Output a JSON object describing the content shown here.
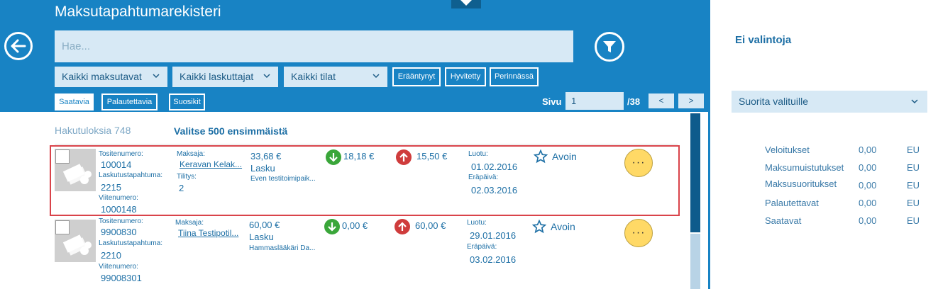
{
  "header": {
    "title": "Maksutapahtumarekisteri",
    "search_placeholder": "Hae...",
    "filters": {
      "payment_types": "Kaikki maksutavat",
      "billers": "Kaikki laskuttajat",
      "states": "Kaikki tilat"
    },
    "toggles": [
      "Erääntynyt",
      "Hyvitetty",
      "Perinnässä"
    ],
    "tabs": [
      "Saatavia",
      "Palautettavia",
      "Suosikit"
    ],
    "pager": {
      "label": "Sivu",
      "current": "1",
      "total": "/38",
      "prev": "<",
      "next": ">"
    }
  },
  "results": {
    "count_text": "Hakutuloksia 748",
    "select_text": "Valitse 500 ensimmäistä",
    "labels": {
      "voucher": "Tositenumero:",
      "billing_event": "Laskutustapahtuma:",
      "reference": "Viitenumero:",
      "payer": "Maksaja:",
      "settlement": "Tilitys:",
      "created": "Luotu:",
      "due": "Eräpäivä:"
    },
    "rows": [
      {
        "voucher": "100014",
        "billing_event": "2215",
        "reference": "1000148",
        "payer": "Keravan Kelak...",
        "settlement": "2",
        "amount": "33,68 €",
        "type": "Lasku",
        "description": "Even testitoimipaik...",
        "incoming": "18,18 €",
        "outgoing": "15,50 €",
        "created": "01.02.2016",
        "due": "02.03.2016",
        "status": "Avoin",
        "more": "···"
      },
      {
        "voucher": "9900830",
        "billing_event": "2210",
        "reference": "99008301",
        "payer": "Tiina Testipotil...",
        "amount": "60,00 €",
        "type": "Lasku",
        "description": "Hammaslääkäri Da...",
        "incoming": "0,00 €",
        "outgoing": "60,00 €",
        "created": "29.01.2016",
        "due": "03.02.2016",
        "status": "Avoin",
        "more": "···"
      }
    ]
  },
  "side_panel": {
    "title": "Ei valintoja",
    "action": "Suorita valituille",
    "summary": [
      {
        "label": "Veloitukset",
        "value": "0,00",
        "unit": "EU"
      },
      {
        "label": "Maksumuistutukset",
        "value": "0,00",
        "unit": "EU"
      },
      {
        "label": "Maksusuoritukset",
        "value": "0,00",
        "unit": "EU"
      },
      {
        "label": "Palautettavat",
        "value": "0,00",
        "unit": "EU"
      },
      {
        "label": "Saatavat",
        "value": "0,00",
        "unit": "EU"
      }
    ]
  },
  "colors": {
    "header_blue": "#1883c4",
    "input_bg": "#d7e9f5",
    "selection_border": "#d9434a",
    "incoming_green": "#3aa63a",
    "outgoing_red": "#cf3c3c",
    "more_button": "#ffd966"
  }
}
